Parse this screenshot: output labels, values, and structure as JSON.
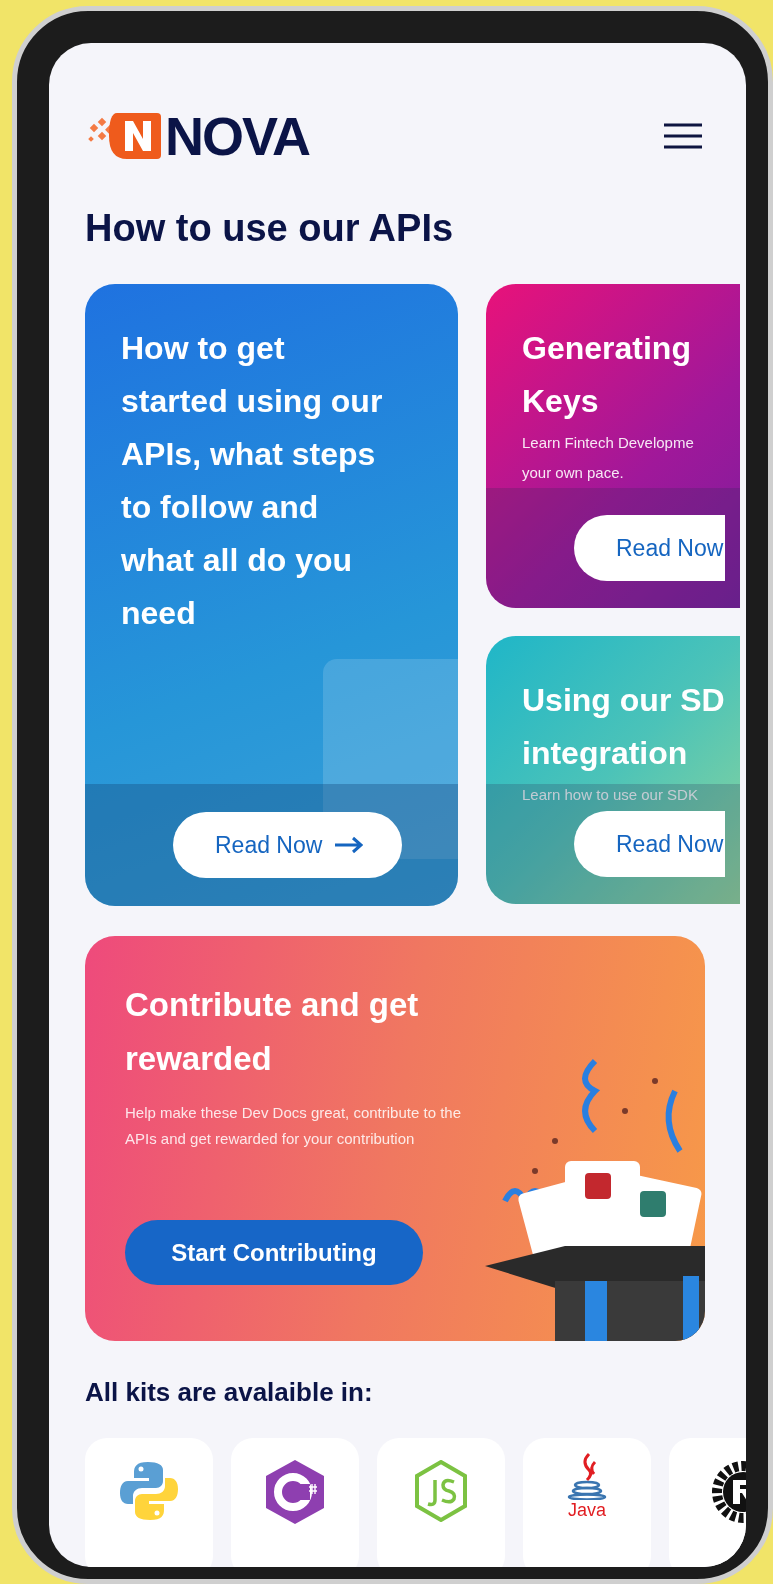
{
  "header": {
    "brand": "NOVA"
  },
  "section_title": "How to use our APIs",
  "cards": [
    {
      "kind": "feature",
      "title_lines": [
        "How to get started using our APIs, what steps to follow and what all do you need"
      ],
      "button": "Read Now"
    },
    {
      "kind": "pink",
      "title_lines": [
        "Generating",
        "Keys"
      ],
      "subtitle_lines": [
        "Learn Fintech Developme",
        "your own pace."
      ],
      "button": "Read Now"
    },
    {
      "kind": "teal",
      "title_lines": [
        "Using our SD",
        "integration"
      ],
      "subtitle_lines": [
        "Learn how to use our SDK"
      ],
      "button": "Read Now"
    }
  ],
  "contribute": {
    "title": "Contribute and get rewarded",
    "text": "Help make these Dev Docs great, contribute to the APIs and get rewarded for your contribution",
    "button": "Start Contributing"
  },
  "kits_title": "All kits are avalaible in:",
  "kits": [
    {
      "kind": "python"
    },
    {
      "kind": "csharp"
    },
    {
      "kind": "nodejs"
    },
    {
      "kind": "java",
      "label": "Java"
    },
    {
      "kind": "rust"
    }
  ]
}
